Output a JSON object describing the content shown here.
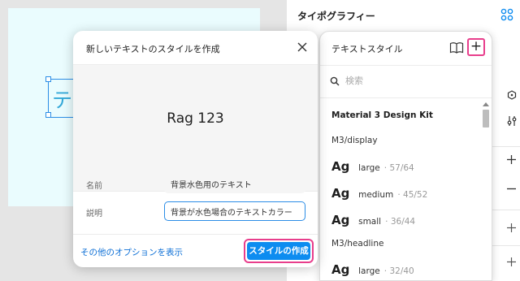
{
  "canvas": {
    "selected_text": "テキ"
  },
  "right_panel": {
    "title": "タイポグラフィー"
  },
  "text_styles": {
    "title": "テキストスタイル",
    "search_placeholder": "検索",
    "library_name": "Material 3 Design Kit",
    "groups": [
      {
        "name": "M3/display",
        "items": [
          {
            "preview": "Ag",
            "name": "large",
            "meta": "· 57/64"
          },
          {
            "preview": "Ag",
            "name": "medium",
            "meta": "· 45/52"
          },
          {
            "preview": "Ag",
            "name": "small",
            "meta": "· 36/44"
          }
        ]
      },
      {
        "name": "M3/headline",
        "items": [
          {
            "preview": "Ag",
            "name": "large",
            "meta": "· 32/40"
          }
        ]
      }
    ]
  },
  "dialog": {
    "title": "新しいテキストのスタイルを作成",
    "preview_text": "Rag 123",
    "name_label": "名前",
    "name_value": "背景水色用のテキスト",
    "description_label": "説明",
    "description_value": "背景が水色場合のテキストカラー",
    "more_options": "その他のオプションを表示",
    "create_button": "スタイルの作成"
  },
  "colors": {
    "accent_blue": "#0d8cf0",
    "highlight_pink": "#e83e8c",
    "frame_fill": "#eafcfe",
    "link_blue": "#0d6fd6"
  }
}
